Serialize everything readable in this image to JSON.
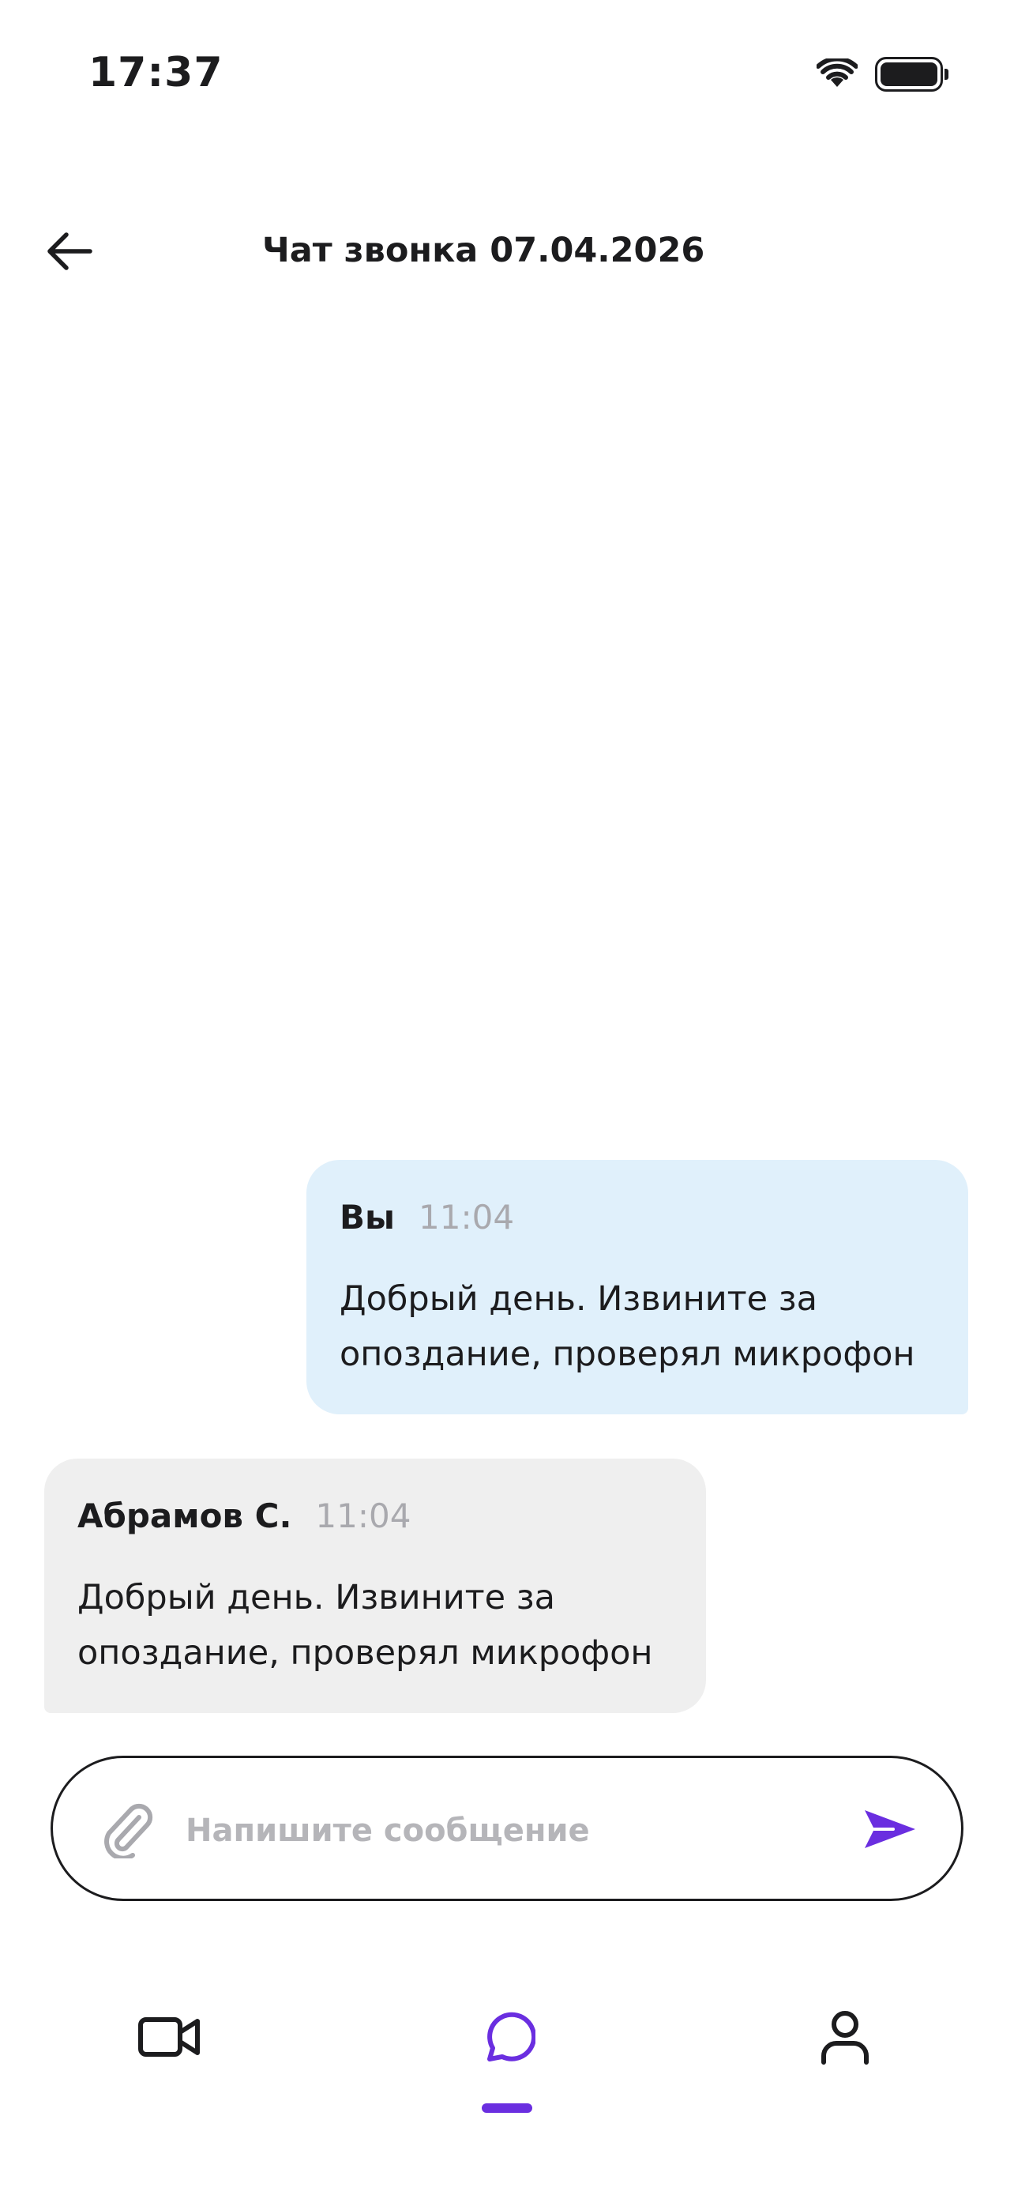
{
  "status_bar": {
    "time": "17:37",
    "icons": [
      "wifi-icon",
      "battery-icon"
    ]
  },
  "header": {
    "back_icon": "arrow-left-icon",
    "title": "Чат звонка 07.04.2026"
  },
  "messages": [
    {
      "direction": "outgoing",
      "author": "Вы",
      "time": "11:04",
      "text": "Добрый день. Извините за\nопоздание, проверял микрофон"
    },
    {
      "direction": "incoming",
      "author": "Абрамов С.",
      "time": "11:04",
      "text": "Добрый день. Извините за\nопоздание, проверял микрофон"
    }
  ],
  "composer": {
    "placeholder": "Напишите сообщение",
    "value": "",
    "attach_icon": "paperclip-icon",
    "send_icon": "send-icon"
  },
  "tab_bar": {
    "tabs": [
      {
        "id": "calls",
        "icon": "video-camera-icon",
        "active": false
      },
      {
        "id": "chat",
        "icon": "chat-bubble-icon",
        "active": true
      },
      {
        "id": "profile",
        "icon": "user-icon",
        "active": false
      }
    ]
  },
  "colors": {
    "accent": "#6a2ee0",
    "outgoing_bubble": "#e0f0fb",
    "incoming_bubble": "#efefef",
    "muted_text": "#a9a9ae",
    "text": "#1c1c1e"
  }
}
